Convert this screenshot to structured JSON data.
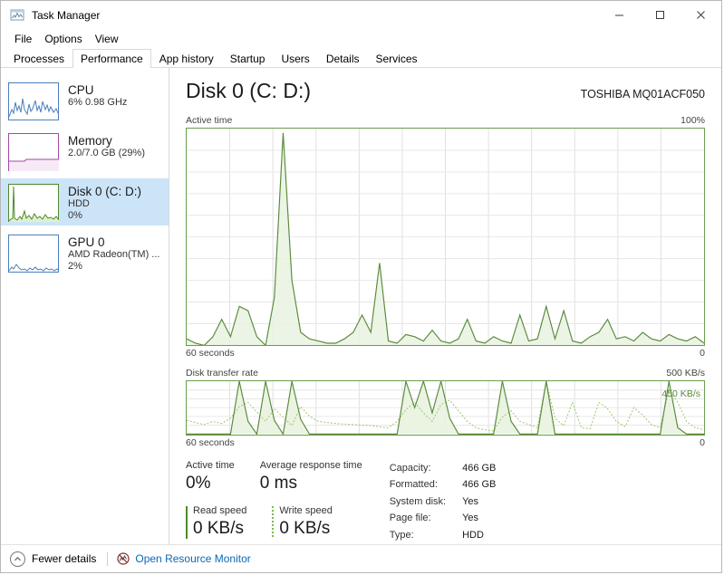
{
  "window": {
    "title": "Task Manager",
    "icon": "task-manager-icon",
    "controls": {
      "minimize": "–",
      "maximize": "☐",
      "close": "✕"
    }
  },
  "menu": {
    "items": [
      "File",
      "Options",
      "View"
    ]
  },
  "tabs": {
    "items": [
      "Processes",
      "Performance",
      "App history",
      "Startup",
      "Users",
      "Details",
      "Services"
    ],
    "active": "Performance"
  },
  "sidebar": {
    "items": [
      {
        "name": "CPU",
        "line1": "6%  0.98 GHz",
        "line2": "",
        "selected": false,
        "color": "#4a7ebb"
      },
      {
        "name": "Memory",
        "line1": "2.0/7.0 GB (29%)",
        "line2": "",
        "selected": false,
        "color": "#a349a4"
      },
      {
        "name": "Disk 0 (C: D:)",
        "line1": "HDD",
        "line2": "0%",
        "selected": true,
        "color": "#4e8a2c"
      },
      {
        "name": "GPU 0",
        "line1": "AMD Radeon(TM) ...",
        "line2": "2%",
        "selected": false,
        "color": "#4a7ebb"
      }
    ]
  },
  "main": {
    "title": "Disk 0 (C: D:)",
    "model": "TOSHIBA MQ01ACF050",
    "active_graph": {
      "caption": "Active time",
      "max_label": "100%",
      "left_foot": "60 seconds",
      "right_foot": "0"
    },
    "rate_graph": {
      "caption": "Disk transfer rate",
      "max_label": "500 KB/s",
      "annotation": "450 KB/s",
      "left_foot": "60 seconds",
      "right_foot": "0"
    },
    "stats": {
      "active_time_label": "Active time",
      "active_time_value": "0%",
      "response_label": "Average response time",
      "response_value": "0 ms",
      "read_label": "Read speed",
      "read_value": "0 KB/s",
      "write_label": "Write speed",
      "write_value": "0 KB/s"
    },
    "info": {
      "rows": [
        {
          "key": "Capacity:",
          "value": "466 GB"
        },
        {
          "key": "Formatted:",
          "value": "466 GB"
        },
        {
          "key": "System disk:",
          "value": "Yes"
        },
        {
          "key": "Page file:",
          "value": "Yes"
        },
        {
          "key": "Type:",
          "value": "HDD"
        }
      ]
    }
  },
  "statusbar": {
    "fewer_details": "Fewer details",
    "resource_monitor": "Open Resource Monitor"
  },
  "colors": {
    "accent_green": "#6a9c4b",
    "fill_green": "#e9f3e0",
    "line_green": "#5a8a3c",
    "write_green": "#9ac468",
    "link_blue": "#0b68b5",
    "selection_blue": "#cce4f7"
  },
  "chart_data": [
    {
      "type": "area",
      "title": "Active time",
      "ylabel": "Active time",
      "xlabel": "60 seconds",
      "ylim": [
        0,
        100
      ],
      "yticks": [
        "0",
        "100%"
      ],
      "grid": true,
      "series": [
        {
          "name": "Active time",
          "values": [
            3,
            1,
            0,
            4,
            12,
            4,
            18,
            16,
            4,
            0,
            22,
            98,
            30,
            6,
            3,
            2,
            1,
            1,
            3,
            6,
            14,
            6,
            38,
            2,
            1,
            5,
            4,
            2,
            7,
            2,
            1,
            3,
            12,
            2,
            1,
            4,
            2,
            1,
            14,
            2,
            3,
            18,
            3,
            16,
            2,
            1,
            4,
            6,
            12,
            3,
            4,
            2,
            6,
            3,
            2,
            5,
            3,
            2,
            4,
            1
          ]
        }
      ]
    },
    {
      "type": "line",
      "title": "Disk transfer rate",
      "ylabel": "Disk transfer rate",
      "xlabel": "60 seconds",
      "ylim": [
        0,
        500
      ],
      "yunit": "KB/s",
      "yticks": [
        "0",
        "500 KB/s"
      ],
      "annotations": [
        {
          "text": "450 KB/s",
          "value": 450
        }
      ],
      "grid": true,
      "series": [
        {
          "name": "Read speed",
          "style": "solid",
          "values": [
            0,
            0,
            0,
            0,
            0,
            0,
            500,
            120,
            0,
            500,
            130,
            0,
            500,
            140,
            0,
            0,
            0,
            0,
            0,
            0,
            0,
            0,
            0,
            0,
            0,
            500,
            250,
            500,
            200,
            500,
            150,
            0,
            0,
            0,
            0,
            0,
            500,
            120,
            0,
            0,
            0,
            500,
            0,
            0,
            0,
            0,
            0,
            0,
            0,
            0,
            0,
            0,
            0,
            0,
            0,
            500,
            60,
            0,
            0,
            0
          ]
        },
        {
          "name": "Write speed",
          "style": "dotted",
          "values": [
            130,
            110,
            90,
            120,
            100,
            150,
            260,
            300,
            210,
            120,
            240,
            160,
            80,
            260,
            170,
            120,
            110,
            100,
            95,
            90,
            85,
            80,
            70,
            60,
            120,
            230,
            300,
            200,
            120,
            280,
            320,
            220,
            120,
            60,
            40,
            30,
            160,
            220,
            120,
            90,
            60,
            500,
            150,
            80,
            300,
            60,
            50,
            300,
            240,
            120,
            70,
            250,
            180,
            90,
            60,
            420,
            300,
            120,
            60,
            40
          ]
        }
      ]
    }
  ]
}
